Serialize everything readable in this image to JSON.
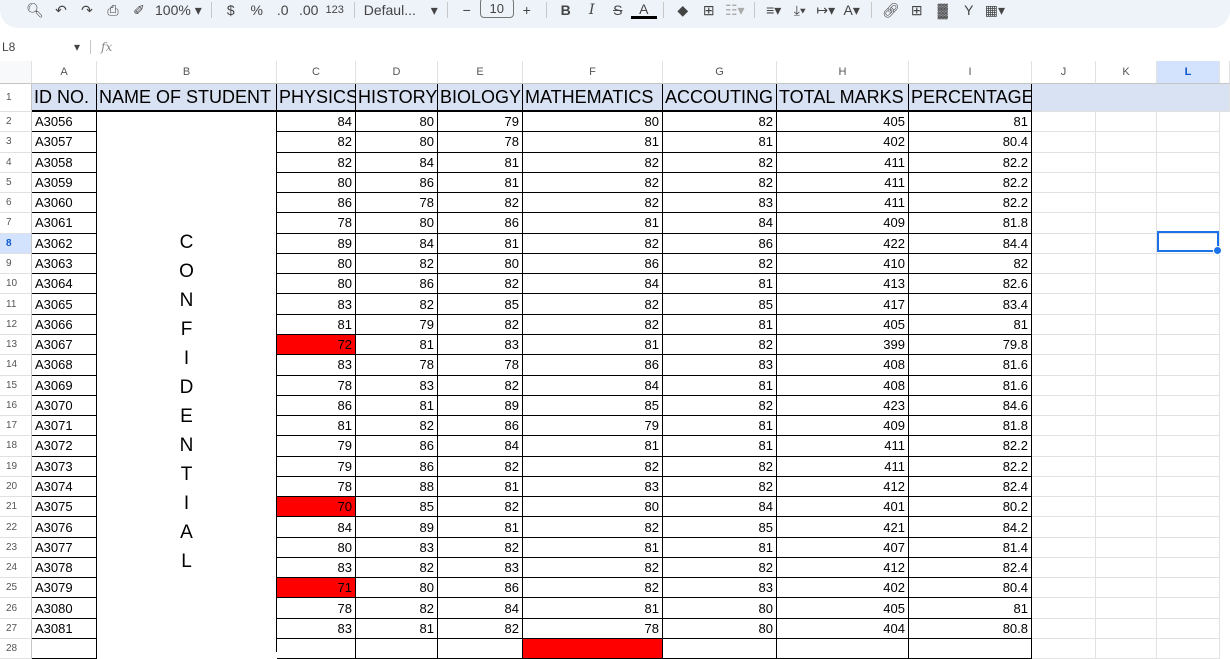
{
  "toolbar": {
    "zoom": "100%",
    "currency": "$",
    "percent": "%",
    "decrease_decimal": ".0",
    "increase_decimal": ".00",
    "format": "123",
    "font": "Defaul...",
    "font_size": "10",
    "bold": "B",
    "italic": "I",
    "strike": "S",
    "text_color": "A"
  },
  "formula_bar": {
    "cell_ref": "L8",
    "fx": "fx",
    "value": ""
  },
  "columns": [
    "A",
    "B",
    "C",
    "D",
    "E",
    "F",
    "G",
    "H",
    "I",
    "J",
    "K",
    "L"
  ],
  "selected_cell": "L8",
  "headers": [
    "ID NO.",
    "NAME OF STUDENT",
    "PHYSICS",
    "HISTORY",
    "BIOLOGY",
    "MATHEMATICS",
    "ACCOUTING",
    "TOTAL MARKS",
    "PERCENTAGE"
  ],
  "merged_name_text": "CONFIDENTIAL",
  "highlight_color": "#ff0000",
  "rows": [
    [
      "A3056",
      84,
      80,
      79,
      80,
      82,
      405,
      81
    ],
    [
      "A3057",
      82,
      80,
      78,
      81,
      81,
      402,
      80.4
    ],
    [
      "A3058",
      82,
      84,
      81,
      82,
      82,
      411,
      82.2
    ],
    [
      "A3059",
      80,
      86,
      81,
      82,
      82,
      411,
      82.2
    ],
    [
      "A3060",
      86,
      78,
      82,
      82,
      83,
      411,
      82.2
    ],
    [
      "A3061",
      78,
      80,
      86,
      81,
      84,
      409,
      81.8
    ],
    [
      "A3062",
      89,
      84,
      81,
      82,
      86,
      422,
      84.4
    ],
    [
      "A3063",
      80,
      82,
      80,
      86,
      82,
      410,
      82
    ],
    [
      "A3064",
      80,
      86,
      82,
      84,
      81,
      413,
      82.6
    ],
    [
      "A3065",
      83,
      82,
      85,
      82,
      85,
      417,
      83.4
    ],
    [
      "A3066",
      81,
      79,
      82,
      82,
      81,
      405,
      81
    ],
    [
      "A3067",
      72,
      81,
      83,
      81,
      82,
      399,
      79.8
    ],
    [
      "A3068",
      83,
      78,
      78,
      86,
      83,
      408,
      81.6
    ],
    [
      "A3069",
      78,
      83,
      82,
      84,
      81,
      408,
      81.6
    ],
    [
      "A3070",
      86,
      81,
      89,
      85,
      82,
      423,
      84.6
    ],
    [
      "A3071",
      81,
      82,
      86,
      79,
      81,
      409,
      81.8
    ],
    [
      "A3072",
      79,
      86,
      84,
      81,
      81,
      411,
      82.2
    ],
    [
      "A3073",
      79,
      86,
      82,
      82,
      82,
      411,
      82.2
    ],
    [
      "A3074",
      78,
      88,
      81,
      83,
      82,
      412,
      82.4
    ],
    [
      "A3075",
      70,
      85,
      82,
      80,
      84,
      401,
      80.2
    ],
    [
      "A3076",
      84,
      89,
      81,
      82,
      85,
      421,
      84.2
    ],
    [
      "A3077",
      80,
      83,
      82,
      81,
      81,
      407,
      81.4
    ],
    [
      "A3078",
      83,
      82,
      83,
      82,
      82,
      412,
      82.4
    ],
    [
      "A3079",
      71,
      80,
      86,
      82,
      83,
      402,
      80.4
    ],
    [
      "A3080",
      78,
      82,
      84,
      81,
      80,
      405,
      81
    ],
    [
      "A3081",
      83,
      81,
      82,
      78,
      80,
      404,
      80.8
    ]
  ]
}
